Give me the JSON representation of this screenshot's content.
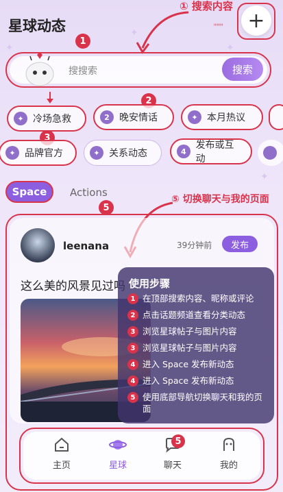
{
  "header": {
    "title": "星球动态",
    "plus_label": "+",
    "tiny_text": "ᴵᴵᴵᴵᴵᴵᴵᴵᴵ"
  },
  "annotations": {
    "search_label": "① 搜索内容",
    "switch_label": "⑤ 切换聊天与我的页面",
    "markers": [
      "1",
      "2",
      "3",
      "5",
      "5"
    ]
  },
  "search": {
    "placeholder": "搜搜索",
    "button": "搜索"
  },
  "topics_row1": [
    {
      "icon": "✦",
      "label": "冷场急救"
    },
    {
      "icon": "2",
      "label": "晚安情话"
    },
    {
      "icon": "✦",
      "label": "本月热议"
    }
  ],
  "topics_row2": [
    {
      "icon": "✦",
      "label": "品牌官方"
    },
    {
      "icon": "✦",
      "label": "关系动态"
    },
    {
      "icon": "4",
      "label": "发布或互动"
    }
  ],
  "tabs": {
    "space": "Space",
    "actions": "Actions"
  },
  "post": {
    "username": "leenana",
    "time": "39分钟前",
    "publish": "发布",
    "text": "这么美的风景见过吗"
  },
  "guide": {
    "title": "使用步骤",
    "steps": [
      {
        "n": "1",
        "text": "在顶部搜索内容、昵称或评论"
      },
      {
        "n": "2",
        "text": "点击话题频道查看分类动态"
      },
      {
        "n": "3",
        "text": "浏览星球帖子与图片内容"
      },
      {
        "n": "3",
        "text": "浏览星球帖子与图片内容"
      },
      {
        "n": "4",
        "text": "进入 Space 发布新动态"
      },
      {
        "n": "4",
        "text": "进入 Space 发布新动态"
      },
      {
        "n": "5",
        "text": "使用底部导航切换聊天和我的页面"
      }
    ]
  },
  "nav": {
    "items": [
      {
        "label": "主页",
        "icon": "home-icon"
      },
      {
        "label": "星球",
        "icon": "planet-icon"
      },
      {
        "label": "聊天",
        "icon": "chat-icon"
      },
      {
        "label": "我的",
        "icon": "profile-icon"
      }
    ],
    "chat_badge": "5"
  },
  "colors": {
    "accent": "#8c5ee0",
    "annotation": "#d8334a"
  }
}
